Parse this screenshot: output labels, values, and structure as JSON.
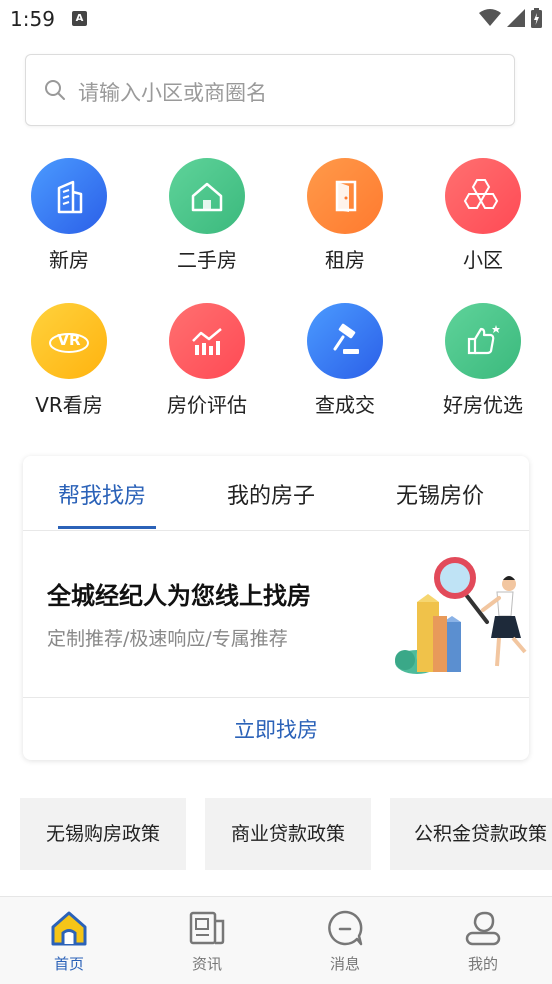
{
  "status_bar": {
    "time": "1:59",
    "notif_badge": "A"
  },
  "search": {
    "placeholder": "请输入小区或商圈名"
  },
  "categories": [
    {
      "label": "新房",
      "icon": "building-icon",
      "color": "#3b7cf0"
    },
    {
      "label": "二手房",
      "icon": "house-icon",
      "color": "#4cc48a"
    },
    {
      "label": "租房",
      "icon": "door-icon",
      "color": "#ff8a3d"
    },
    {
      "label": "小区",
      "icon": "hexagon-icon",
      "color": "#ff5a5f"
    },
    {
      "label": "VR看房",
      "icon": "vr-icon",
      "color": "#ffc222"
    },
    {
      "label": "房价评估",
      "icon": "chart-icon",
      "color": "#ff5a5f"
    },
    {
      "label": "查成交",
      "icon": "gavel-icon",
      "color": "#3b7cf0"
    },
    {
      "label": "好房优选",
      "icon": "thumbs-up-icon",
      "color": "#4cc48a"
    }
  ],
  "card": {
    "tabs": [
      "帮我找房",
      "我的房子",
      "无锡房价"
    ],
    "active_tab": 0,
    "title": "全城经纪人为您线上找房",
    "subtitle": "定制推荐/极速响应/专属推荐",
    "action": "立即找房"
  },
  "policies": [
    "无锡购房政策",
    "商业贷款政策",
    "公积金贷款政策"
  ],
  "bottom_nav": [
    {
      "label": "首页",
      "icon": "home-icon",
      "active": true
    },
    {
      "label": "资讯",
      "icon": "news-icon",
      "active": false
    },
    {
      "label": "消息",
      "icon": "message-icon",
      "active": false
    },
    {
      "label": "我的",
      "icon": "profile-icon",
      "active": false
    }
  ],
  "colors": {
    "accent": "#2b62b8",
    "active_nav_fill": "#f5c518"
  }
}
